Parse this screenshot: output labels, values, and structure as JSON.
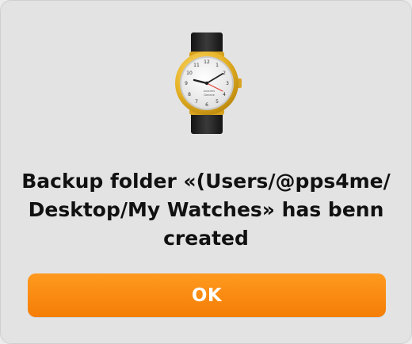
{
  "dialog": {
    "icon": "wristwatch-icon",
    "message_lines": [
      "Backup folder «(Users/@pps4me/",
      "Desktop/My Watches» has benn",
      "created"
    ],
    "ok_label": "OK"
  },
  "watch": {
    "brand_line1": "WATCHES",
    "brand_line2": "Geneve"
  },
  "colors": {
    "dialog_background": "#e3e3e3",
    "button_orange": "#f98a10",
    "button_text": "#ffffff",
    "message_text": "#111111",
    "watch_gold": "#e8b428",
    "strap": "#262626",
    "second_hand": "#e33b2f"
  }
}
